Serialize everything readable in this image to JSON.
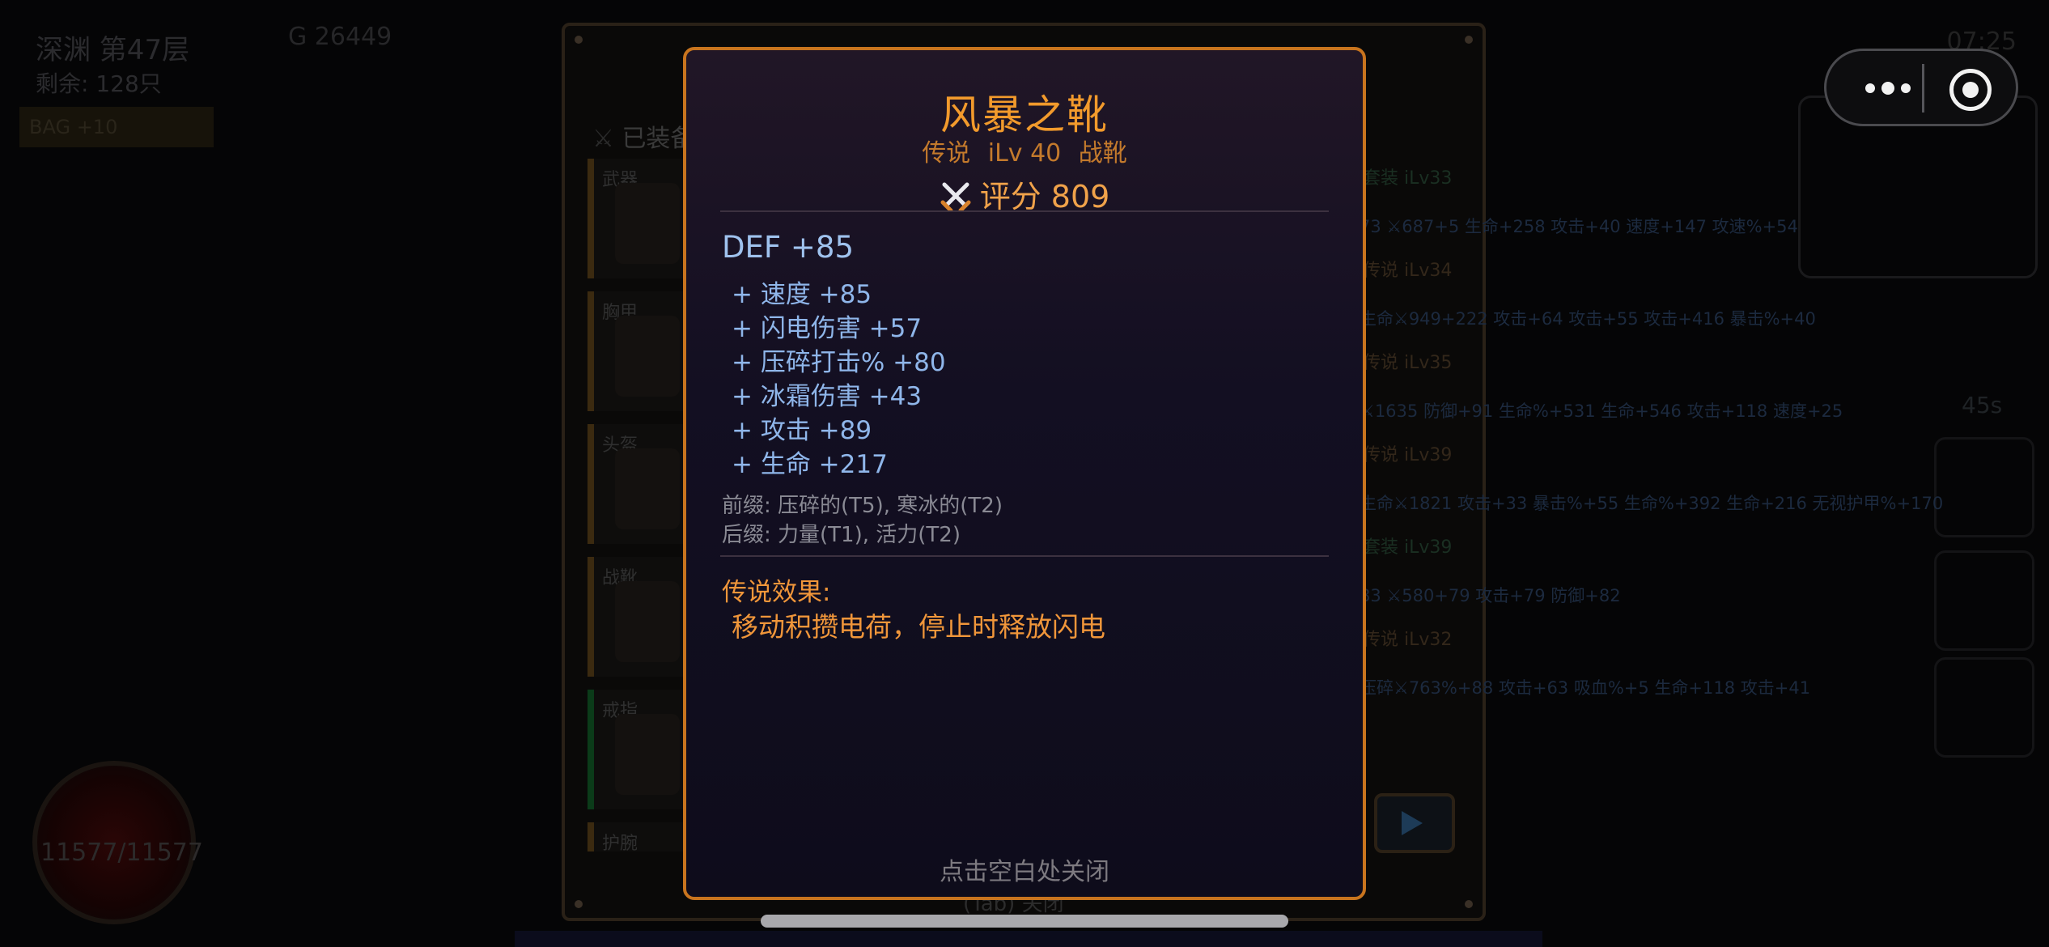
{
  "hud": {
    "level": "深渊 第47层",
    "remaining": "剩余: 128只",
    "gold": "G 26449",
    "bag": "BAG +10",
    "time": "07:25",
    "hp": "11577/11577",
    "timer": "45s"
  },
  "equipment_panel": {
    "header": "已装备",
    "slots": [
      {
        "label": "武器"
      },
      {
        "label": "胸甲"
      },
      {
        "label": "头盔"
      },
      {
        "label": "战靴"
      },
      {
        "label": "戒指"
      },
      {
        "label": "护腕"
      }
    ],
    "rows": [
      {
        "head": "套装 iLv33",
        "score": "687",
        "stats": "73 ⚔687+5 生命+258 攻击+40 速度+147 攻速%+54"
      },
      {
        "head": "传说 iLv34",
        "score": "949",
        "stats": "生命⚔949+222 攻击+64 攻击+55 攻击+416 暴击%+40"
      },
      {
        "head": "传说 iLv35",
        "score": "1635",
        "stats": "⚔1635 防御+91 生命%+531 生命+546 攻击+118 速度+25"
      },
      {
        "head": "传说 iLv39",
        "score": "1821",
        "stats": "生命⚔1821 攻击+33 暴击%+55 生命%+392 生命+216 无视护甲%+170"
      },
      {
        "head": "套装 iLv39",
        "score": "580",
        "stats": "83 ⚔580+79 攻击+79 防御+82"
      },
      {
        "head": "传说 iLv32",
        "score": "763",
        "stats": "压碎⚔763%+88 攻击+63 吸血%+5 生命+118 攻击+41"
      }
    ],
    "footer": "(Tab) 关闭"
  },
  "tooltip": {
    "name": "风暴之靴",
    "rarity": "传说",
    "ilv": "iLv 40",
    "slot": "战靴",
    "score_label": "评分 809",
    "base_stat": "DEF +85",
    "affixes": [
      "+ 速度 +85",
      "+ 闪电伤害 +57",
      "+ 压碎打击% +80",
      "+ 冰霜伤害 +43",
      "+ 攻击 +89",
      "+ 生命 +217"
    ],
    "prefix": "前缀: 压碎的(T5), 寒冰的(T2)",
    "suffix": "后缀: 力量(T1), 活力(T2)",
    "legend_title": "传说效果:",
    "legend_text": "移动积攒电荷，停止时释放闪电",
    "close_hint": "点击空白处关闭"
  },
  "colors": {
    "accent_orange": "#f29a2c",
    "border_orange": "#c8741e",
    "stat_blue": "#8fb6ea",
    "meta_gray": "#8a8a94"
  },
  "icons": {
    "score": "crossed-swords-icon",
    "capsule_more": "more-dots-icon",
    "capsule_close": "close-target-icon"
  }
}
